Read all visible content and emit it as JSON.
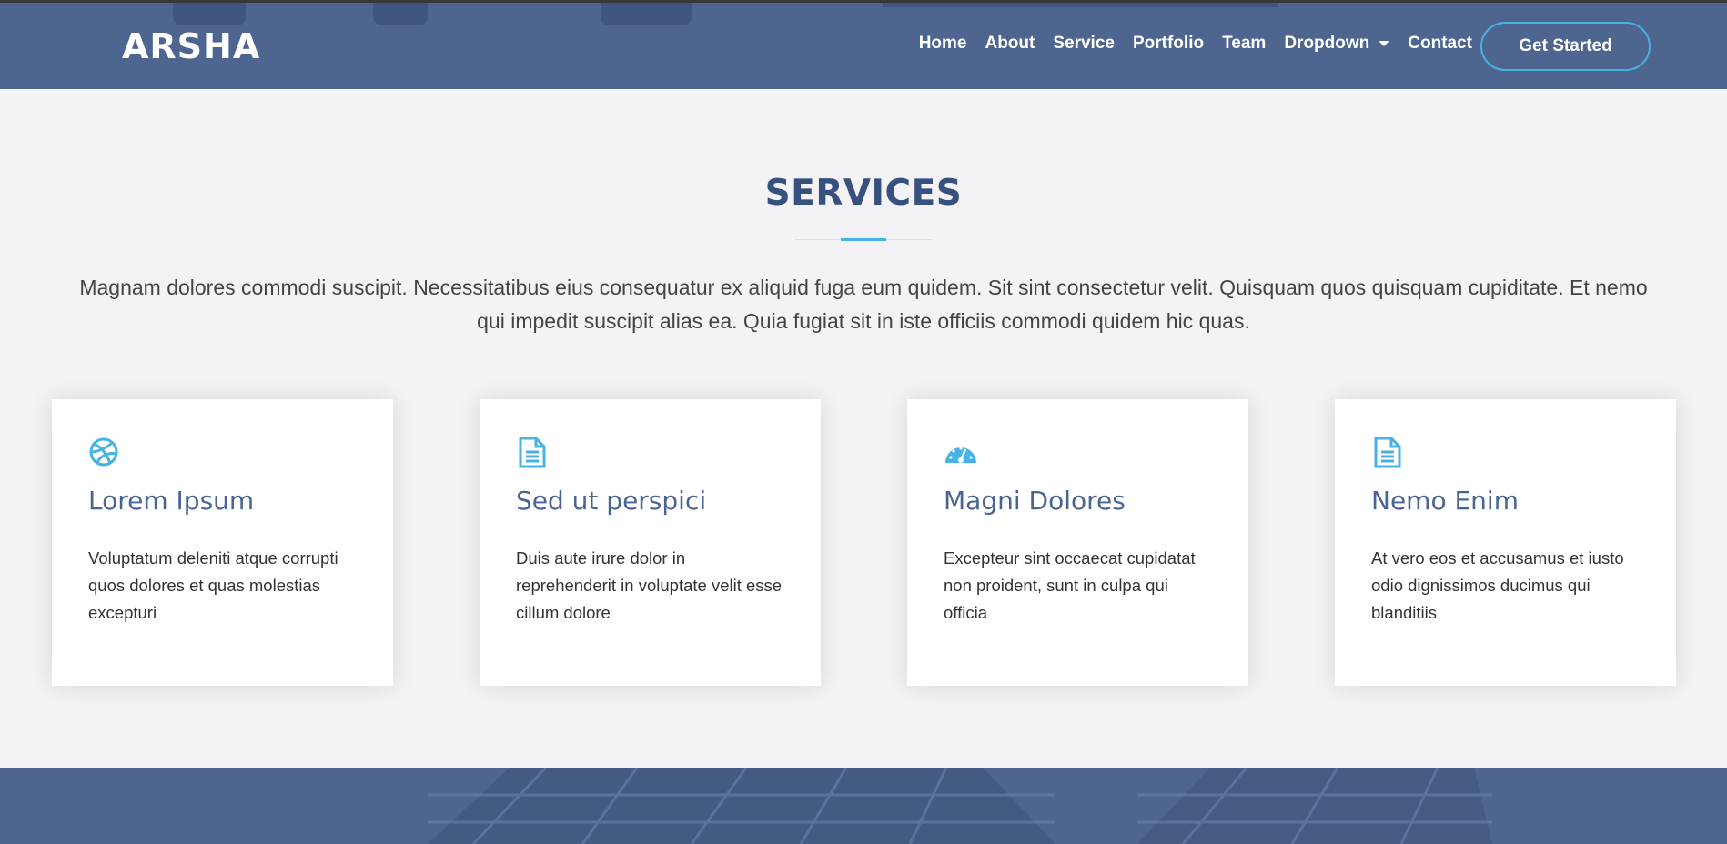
{
  "header": {
    "logo": "ARSHA",
    "nav": [
      {
        "label": "Home"
      },
      {
        "label": "About"
      },
      {
        "label": "Service"
      },
      {
        "label": "Portfolio"
      },
      {
        "label": "Team"
      },
      {
        "label": "Dropdown"
      },
      {
        "label": "Contact"
      }
    ],
    "cta_label": "Get Started"
  },
  "services": {
    "title": "SERVICES",
    "description": "Magnam dolores commodi suscipit. Necessitatibus eius consequatur ex aliquid fuga eum quidem. Sit sint consectetur velit. Quisquam quos quisquam cupiditate. Et nemo qui impedit suscipit alias ea. Quia fugiat sit in iste officiis commodi quidem hic quas.",
    "cards": [
      {
        "icon": "dribbble-icon",
        "title": "Lorem Ipsum",
        "text": "Voluptatum deleniti atque corrupti quos dolores et quas molestias excepturi"
      },
      {
        "icon": "file-icon",
        "title": "Sed ut perspici",
        "text": "Duis aute irure dolor in reprehenderit in voluptate velit esse cillum dolore"
      },
      {
        "icon": "speedometer-icon",
        "title": "Magni Dolores",
        "text": "Excepteur sint occaecat cupidatat non proident, sunt in culpa qui officia"
      },
      {
        "icon": "file-icon",
        "title": "Nemo Enim",
        "text": "At vero eos et accusamus et iusto odio dignissimos ducimus qui blanditiis"
      }
    ]
  },
  "colors": {
    "header_bg": "#4e6590",
    "accent": "#47b2e4",
    "heading": "#37517e",
    "page_bg": "#f3f3f5"
  }
}
